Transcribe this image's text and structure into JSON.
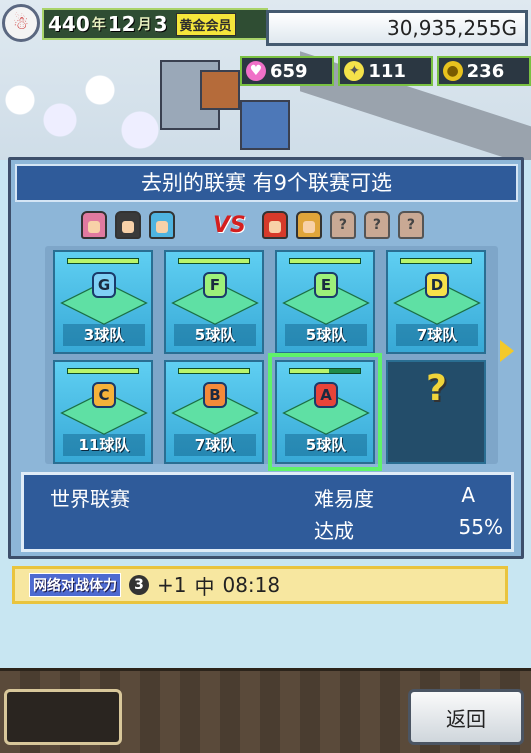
{
  "status": {
    "year": "440",
    "year_unit": "年",
    "month": "12",
    "month_unit": "月",
    "day": "3",
    "member": "黄金会员",
    "money": "30,935,255G"
  },
  "stats": {
    "hearts": "659",
    "ideas": "111",
    "coins": "236"
  },
  "panel": {
    "title": "去别的联赛  有9个联赛可选",
    "vs_label": "VS",
    "tiles": [
      {
        "grade": "G",
        "count": "3",
        "unit": "球队",
        "progress": 1.0,
        "badge_color": "#7fd0f5"
      },
      {
        "grade": "F",
        "count": "5",
        "unit": "球队",
        "progress": 1.0,
        "badge_color": "#9df07a"
      },
      {
        "grade": "E",
        "count": "5",
        "unit": "球队",
        "progress": 1.0,
        "badge_color": "#9df07a"
      },
      {
        "grade": "D",
        "count": "7",
        "unit": "球队",
        "progress": 1.0,
        "badge_color": "#f5e24a"
      },
      {
        "grade": "C",
        "count": "11",
        "unit": "球队",
        "progress": 1.0,
        "badge_color": "#f5b23a"
      },
      {
        "grade": "B",
        "count": "7",
        "unit": "球队",
        "progress": 1.0,
        "badge_color": "#f58a3a"
      },
      {
        "grade": "A",
        "count": "5",
        "unit": "球队",
        "progress": 0.55,
        "badge_color": "#e8443a"
      },
      {
        "grade": "?",
        "locked": true
      }
    ],
    "info": {
      "league_name": "世界联赛",
      "difficulty_label": "难易度",
      "difficulty_value": "A",
      "progress_label": "达成",
      "progress_value": "55%"
    }
  },
  "network": {
    "label": "网络对战体力",
    "count": "3",
    "delta": "+1",
    "level": "中",
    "timer": "08:18"
  },
  "buttons": {
    "back": "返回"
  },
  "colors": {
    "panel_title_bg": "#2f5b9a",
    "selected_outline": "#5ff26a",
    "tile_bg": "#5fcff2"
  }
}
